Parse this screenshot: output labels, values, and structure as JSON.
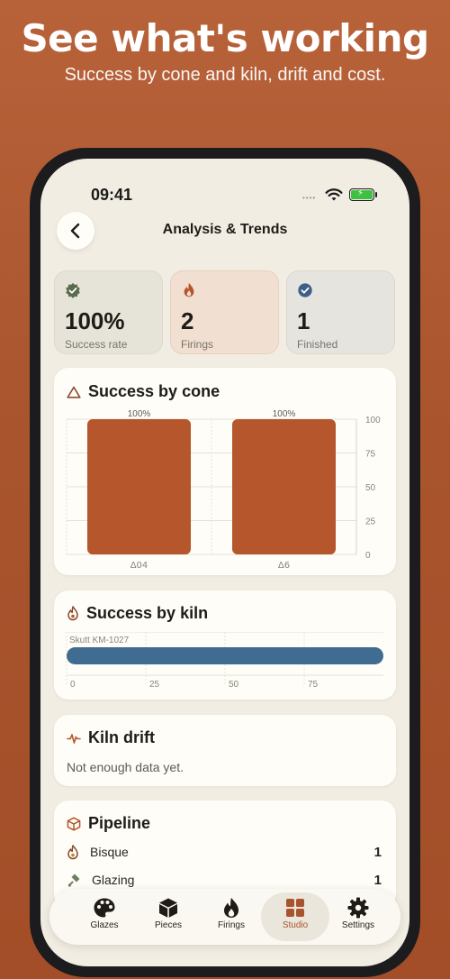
{
  "promo": {
    "title": "See what's working",
    "subtitle": "Success by cone and kiln, drift and cost."
  },
  "status_bar": {
    "time": "09:41",
    "signal": "••••"
  },
  "nav": {
    "title": "Analysis & Trends"
  },
  "stats": [
    {
      "value": "100%",
      "label": "Success rate",
      "icon": "check-badge-icon",
      "color": "#5a6b4e"
    },
    {
      "value": "2",
      "label": "Firings",
      "icon": "flame-icon",
      "color": "#b5562c"
    },
    {
      "value": "1",
      "label": "Finished",
      "icon": "check-circle-icon",
      "color": "#3c5f86"
    }
  ],
  "cone_card": {
    "title": "Success by cone",
    "icon": "cone-triangle-icon"
  },
  "kiln_card": {
    "title": "Success by kiln",
    "icon": "kiln-flame-icon"
  },
  "drift_card": {
    "title": "Kiln drift",
    "icon": "pulse-icon",
    "message": "Not enough data yet."
  },
  "pipeline_card": {
    "title": "Pipeline",
    "icon": "box-icon",
    "rows": [
      {
        "label": "Bisque",
        "count": "1",
        "icon": "bisque-flame-icon"
      },
      {
        "label": "Glazing",
        "count": "1",
        "icon": "glaze-brush-icon"
      }
    ]
  },
  "tabs": [
    {
      "label": "Glazes",
      "icon": "palette-icon"
    },
    {
      "label": "Pieces",
      "icon": "cube-icon"
    },
    {
      "label": "Firings",
      "icon": "flame-icon"
    },
    {
      "label": "Studio",
      "icon": "grid-icon",
      "active": true
    },
    {
      "label": "Settings",
      "icon": "gear-icon"
    }
  ],
  "colors": {
    "accent": "#a9542d",
    "bar_cone": "#b5562c",
    "bar_kiln": "#3f6c90",
    "background": "#f2ede3"
  },
  "chart_data": [
    {
      "type": "bar",
      "categories": [
        "Δ04",
        "Δ6"
      ],
      "values": [
        100,
        100
      ],
      "data_labels": [
        "100%",
        "100%"
      ],
      "y_ticks": [
        "100",
        "75",
        "50",
        "25",
        "0"
      ],
      "ylim": [
        0,
        100
      ],
      "grid": true,
      "orientation": "vertical"
    },
    {
      "type": "bar",
      "categories": [
        "Skutt KM-1027"
      ],
      "values": [
        100
      ],
      "x_ticks": [
        "0",
        "25",
        "50",
        "75"
      ],
      "xlim": [
        0,
        100
      ],
      "grid": true,
      "orientation": "horizontal"
    }
  ]
}
